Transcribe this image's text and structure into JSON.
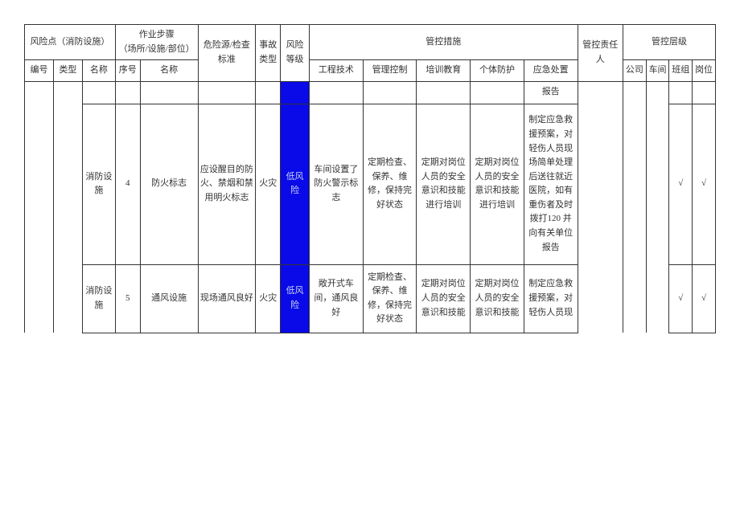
{
  "headers": {
    "risk_point": "风险点（消防设施）",
    "work_step": "作业步骤\n（场所/设施/部位）",
    "hazard_check": "危险源/检查标准",
    "accident_type": "事故类型",
    "risk_level": "风险等级",
    "control_measures": "管控措施",
    "responsible": "管控责任人",
    "control_level": "管控层级",
    "id": "编号",
    "type": "类型",
    "name": "名称",
    "seq": "序号",
    "name2": "名称",
    "engineering": "工程技术",
    "management": "管理控制",
    "training": "培训教育",
    "protection": "个体防护",
    "emergency": "应急处置",
    "company": "公司",
    "workshop": "车间",
    "team": "班组",
    "post": "岗位"
  },
  "rows": [
    {
      "emergency": "报告"
    },
    {
      "name": "消防设施",
      "seq": "4",
      "step_name": "防火标志",
      "hazard": "应设醒目的防火、禁烟和禁用明火标志",
      "accident": "火灾",
      "risk": "低风险",
      "engineering": "车间设置了防火警示标志",
      "management": "定期检查、保养、维修，保持完好状态",
      "training": "定期对岗位人员的安全意识和技能进行培训",
      "protection": "定期对岗位人员的安全意识和技能进行培训",
      "emergency": "制定应急救援预案，对轻伤人员现场简单处理后送往就近医院，如有重伤者及时拨打120 并向有关单位报告",
      "team": "√",
      "post": "√"
    },
    {
      "name": "消防设施",
      "seq": "5",
      "step_name": "通风设施",
      "hazard": "现场通风良好",
      "accident": "火灾",
      "risk": "低风险",
      "engineering": "敞开式车间，通风良好",
      "management": "定期检查、保养、维修，保持完好状态",
      "training": "定期对岗位人员的安全意识和技能",
      "protection": "定期对岗位人员的安全意识和技能",
      "emergency": "制定应急救援预案，对轻伤人员现",
      "team": "√",
      "post": "√"
    }
  ]
}
